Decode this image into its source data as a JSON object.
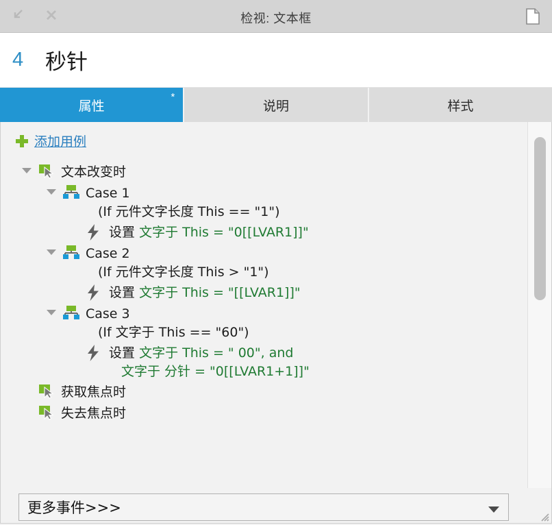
{
  "titlebar": {
    "minimize_icon": "arrow-down-left-icon",
    "close_icon": "close-icon",
    "title": "检视: 文本框",
    "document_icon": "document-icon"
  },
  "header": {
    "number": "4",
    "name": "秒针"
  },
  "tabs": [
    {
      "label": "属性",
      "active": true,
      "modified_marker": "*"
    },
    {
      "label": "说明",
      "active": false,
      "modified_marker": ""
    },
    {
      "label": "样式",
      "active": false,
      "modified_marker": ""
    }
  ],
  "add_case": {
    "icon": "plus-icon",
    "label": "添加用例"
  },
  "tree": {
    "event": {
      "icon": "event-cursor-icon",
      "caret": "caret-down-icon",
      "label": "文本改变时"
    },
    "cases": [
      {
        "caret": "caret-down-icon",
        "icon": "case-branch-icon",
        "title": "Case 1",
        "condition": "(If 元件文字长度 This == \"1\")",
        "action": {
          "icon": "lightning-icon",
          "verb": "设置",
          "expression": "文字于 This = \"0[[LVAR1]]\"",
          "expression_line2": ""
        }
      },
      {
        "caret": "caret-down-icon",
        "icon": "case-branch-icon",
        "title": "Case 2",
        "condition": "(If 元件文字长度 This > \"1\")",
        "action": {
          "icon": "lightning-icon",
          "verb": "设置",
          "expression": "文字于 This = \"[[LVAR1]]\"",
          "expression_line2": ""
        }
      },
      {
        "caret": "caret-down-icon",
        "icon": "case-branch-icon",
        "title": "Case 3",
        "condition": "(If 文字于 This == \"60\")",
        "action": {
          "icon": "lightning-icon",
          "verb": "设置",
          "expression": "文字于 This = \" 00\", and",
          "expression_line2": "文字于 分针 = \"0[[LVAR1+1]]\""
        }
      }
    ],
    "other_events": [
      {
        "icon": "event-cursor-icon",
        "label": "获取焦点时"
      },
      {
        "icon": "event-cursor-icon",
        "label": "失去焦点时"
      }
    ]
  },
  "footer": {
    "more_events_label": "更多事件>>>",
    "dropdown_icon": "chevron-down-icon",
    "resize_grip_icon": "resize-grip-icon"
  },
  "colors": {
    "accent_blue": "#2196d3",
    "link_blue": "#2b7fbf",
    "number_blue": "#2e8fc6",
    "green_icon": "#7ab929",
    "green_text": "#1f7a32",
    "case_blue": "#1b9ad6",
    "titlebar_bg": "#d4d4d4",
    "body_bg": "#f2f2f2"
  }
}
